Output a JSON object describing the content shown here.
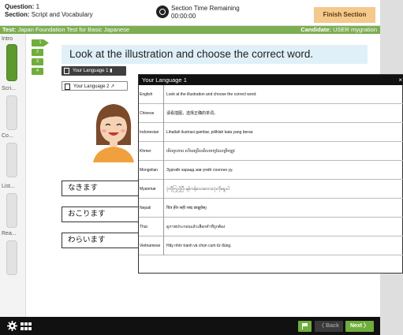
{
  "header": {
    "question_label": "Question:",
    "question_value": "1",
    "section_label": "Section:",
    "section_value": "Script and Vocabulary",
    "timer_title": "Section Time Remaining",
    "timer_value": "00:00:00",
    "finish_label": "Finish Section"
  },
  "subheader": {
    "test_label": "Test:",
    "test_value": "Japan Foundation Test for Basic Japanese",
    "candidate_label": "Candidate:",
    "candidate_value": "USER mygration"
  },
  "sidebar": {
    "sections": [
      {
        "label": "Intro",
        "active": true
      },
      {
        "label": "Scri...",
        "active": false
      },
      {
        "label": "Co...",
        "active": false
      },
      {
        "label": "List...",
        "active": false
      },
      {
        "label": "Rea...",
        "active": false
      }
    ]
  },
  "question_nav": [
    "1",
    "2",
    "3",
    "4"
  ],
  "main": {
    "instruction": "Look at the illustration and choose the correct word.",
    "language_button_1": "Your Language 1",
    "language_button_2": "Your Language 2",
    "options": [
      "なきます",
      "おこります",
      "わらいます"
    ]
  },
  "popup": {
    "title": "Your Language 1",
    "close": "×",
    "rows": [
      {
        "lang": "English",
        "text": "Look at the illustration and choose the correct word."
      },
      {
        "lang": "Chinese",
        "text": "请看插图，选择正确的单词。"
      },
      {
        "lang": "Indonesian",
        "text": "Lihatlah ilustrasi gambar, pilihlah kata yang benar."
      },
      {
        "lang": "Khmer",
        "text": "មើលរូបភាព ហើយជ្រើសរើសពាក្យដែលត្រឹមត្រូវ"
      },
      {
        "lang": "Mongolian",
        "text": "Зургийг хараад зөв үгийг сонгоно уу."
      },
      {
        "lang": "Myanmar",
        "text": "ပုံကိုကြည့်ပြီး မှန်ကန်သောစကားလုံးကိုရွေးပါ"
      },
      {
        "lang": "Nepali",
        "text": "चित्र हेरेर सही शब्द छान्नुहोस्।"
      },
      {
        "lang": "Thai",
        "text": "ดูภาพประกอบแล้วเลือกคำที่ถูกต้อง"
      },
      {
        "lang": "Vietnamese",
        "text": "Hãy nhìn tranh và chọn cum từ đúng."
      }
    ]
  },
  "footer": {
    "back_label": "〈 Back",
    "next_label": "Next 〉"
  },
  "colors": {
    "green": "#6fae3b",
    "finish_bg": "#f4c98b",
    "instruction_bg": "#dff0f8",
    "dark": "#111111"
  },
  "icons": {
    "timer": "clock-icon",
    "settings": "gear-icon",
    "grid": "grid-icon",
    "flag": "flag-icon"
  }
}
